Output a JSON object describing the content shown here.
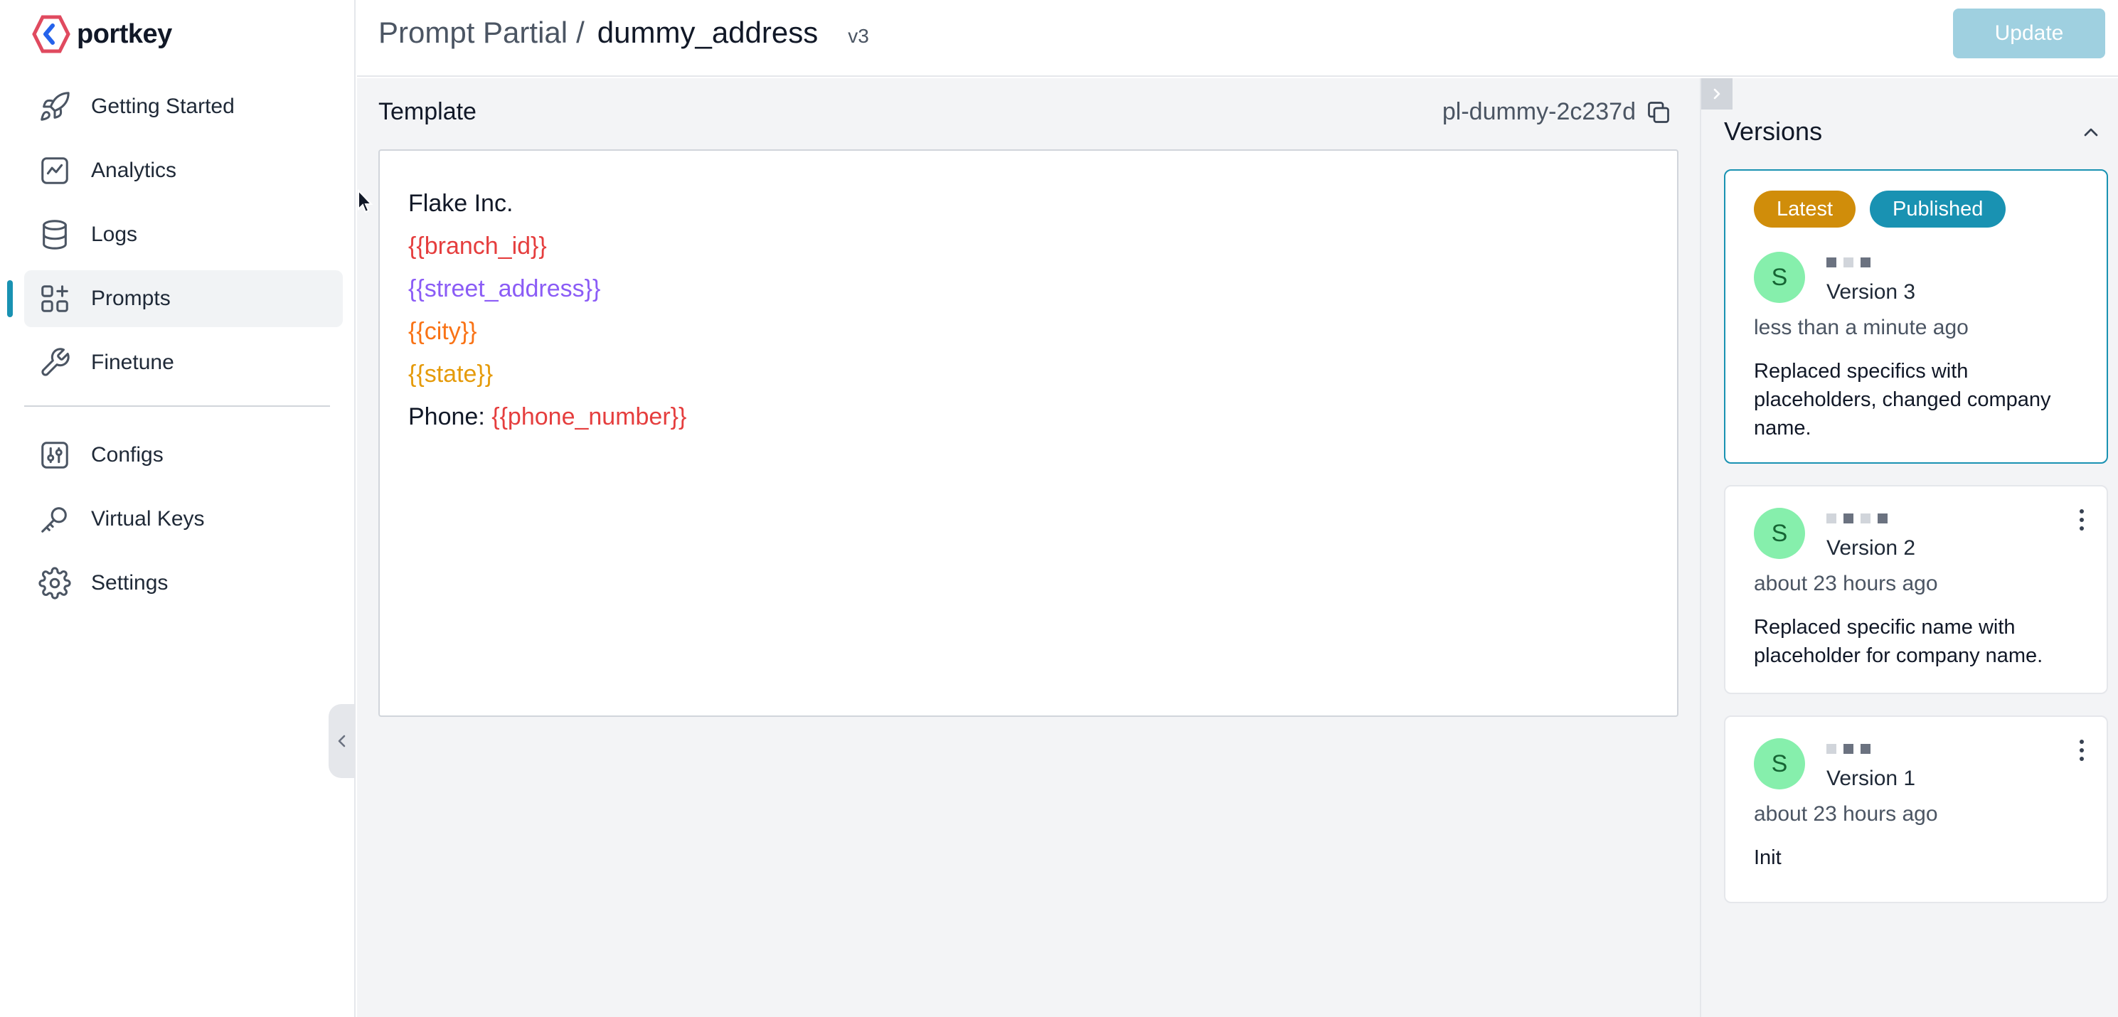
{
  "brand": {
    "name": "portkey"
  },
  "sidebar": {
    "items": [
      {
        "label": "Getting Started",
        "icon": "rocket-icon"
      },
      {
        "label": "Analytics",
        "icon": "chart-line-icon"
      },
      {
        "label": "Logs",
        "icon": "database-icon"
      },
      {
        "label": "Prompts",
        "icon": "grid-plus-icon",
        "active": true
      },
      {
        "label": "Finetune",
        "icon": "wrench-icon"
      }
    ],
    "secondary_items": [
      {
        "label": "Configs",
        "icon": "sliders-icon"
      },
      {
        "label": "Virtual Keys",
        "icon": "key-icon"
      },
      {
        "label": "Settings",
        "icon": "gear-icon"
      }
    ]
  },
  "header": {
    "parent": "Prompt Partial",
    "separator": "/",
    "current": "dummy_address",
    "version": "v3",
    "update_label": "Update"
  },
  "template": {
    "title": "Template",
    "id": "pl-dummy-2c237d",
    "lines": {
      "company": "Flake Inc.",
      "branch": "{{branch_id}}",
      "street": "{{street_address}}",
      "city": "{{city}}",
      "state": "{{state}}",
      "phone_prefix": "Phone: ",
      "phone_var": "{{phone_number}}"
    }
  },
  "versions": {
    "title": "Versions",
    "items": [
      {
        "badges": [
          "Latest",
          "Published"
        ],
        "avatar": "S",
        "label": "Version 3",
        "time": "less than a minute ago",
        "description": "Replaced specifics with placeholders, changed company name."
      },
      {
        "avatar": "S",
        "label": "Version 2",
        "time": "about 23 hours ago",
        "description": "Replaced specific name with placeholder for company name."
      },
      {
        "avatar": "S",
        "label": "Version 1",
        "time": "about 23 hours ago",
        "description": "Init"
      }
    ]
  },
  "colors": {
    "accent": "#1992b2",
    "latest_badge": "#d08d0a",
    "update_button": "#9fd0e0",
    "avatar": "#86efac"
  }
}
